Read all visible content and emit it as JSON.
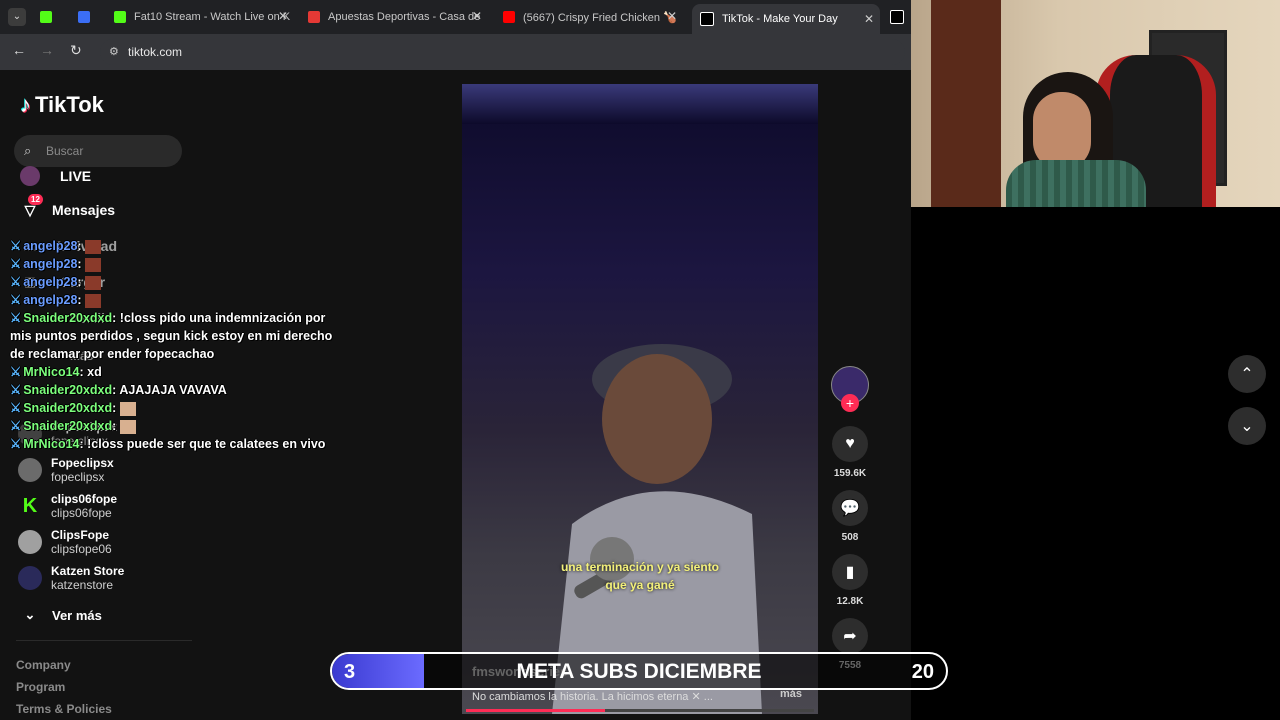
{
  "browser": {
    "tabs": [
      {
        "label": "",
        "color": "#53fc18"
      },
      {
        "label": "",
        "color": "#3b6ef5"
      },
      {
        "label": "Fat10 Stream - Watch Live on K",
        "color": "#53fc18"
      },
      {
        "label": "Apuestas Deportivas - Casa de",
        "color": "#e53935"
      },
      {
        "label": "(5667) Crispy Fried Chicken 🍗",
        "color": "#ff0000"
      },
      {
        "label": "TikTok - Make Your Day",
        "color": "#ffffff"
      }
    ],
    "url": "tiktok.com"
  },
  "sidebar": {
    "logo": "TikTok",
    "search_placeholder": "Buscar",
    "nav": [
      {
        "label": "LIVE",
        "icon": "live-icon"
      },
      {
        "label": "Mensajes",
        "icon": "message-icon",
        "badge": "12"
      },
      {
        "label": "Actividad",
        "icon": "activity-icon"
      },
      {
        "label": "Cargar",
        "icon": "upload-icon"
      },
      {
        "label": "Perfil",
        "icon": "profile-icon"
      },
      {
        "label": "Más",
        "icon": "more-icon"
      }
    ],
    "following": [
      {
        "name": "Fope.clipsx",
        "handle": "fope.clipsx"
      },
      {
        "name": "Fopeclipsx",
        "handle": "fopeclipsx"
      },
      {
        "name": "clips06fope",
        "handle": "clips06fope"
      },
      {
        "name": "ClipsFope",
        "handle": "clipsfope06"
      },
      {
        "name": "Katzen Store",
        "handle": "katzenstore"
      }
    ],
    "see_more": "Ver más",
    "footer": [
      "Company",
      "Program",
      "Terms & Policies"
    ]
  },
  "video": {
    "caption_line1": "una terminación y ya siento",
    "caption_line2": "que ya gané",
    "username": "fmsworldseries",
    "description": "No cambiamos la historia. La hicimos eterna ✕ ...",
    "more": "más",
    "progress": 0.4
  },
  "actions": {
    "likes": "159.6K",
    "comments": "508",
    "saves": "12.8K",
    "shares": "7558"
  },
  "chat": [
    {
      "user": "angelp28",
      "msg": ""
    },
    {
      "user": "angelp28",
      "msg": ""
    },
    {
      "user": "angelp28",
      "msg": ""
    },
    {
      "user": "angelp28",
      "msg": ""
    },
    {
      "user": "Snaider20xdxd",
      "msg": "!closs pido una indemnización por mis puntos perdidos , segun kick estoy en mi derecho de reclamar por ender fopecachao"
    },
    {
      "user": "MrNico14",
      "msg": "xd"
    },
    {
      "user": "Snaider20xdxd",
      "msg": "AJAJAJA VAVAVA"
    },
    {
      "user": "Snaider20xdxd",
      "msg": ""
    },
    {
      "user": "Snaider20xdxd",
      "msg": ""
    },
    {
      "user": "MrNico14",
      "msg": "!closs puede ser que te calatees en vivo"
    }
  ],
  "goal": {
    "title": "META SUBS DICIEMBRE",
    "current": "3",
    "target": "20",
    "progress": 0.15,
    "fill_color": "#4a4ae0"
  }
}
